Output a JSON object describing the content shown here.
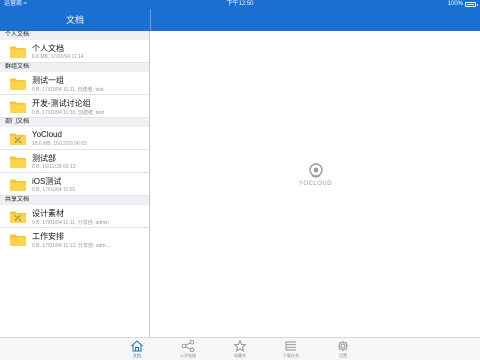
{
  "status_bar": {
    "carrier": "运营商 ≈",
    "time": "下午12:50",
    "battery": "100%"
  },
  "nav": {
    "title": "文档"
  },
  "sections": [
    {
      "header": "个人文档",
      "items": [
        {
          "name": "个人文档",
          "meta": "6.6 MB, 17/01/04 11:14",
          "icon": "folder-icon"
        }
      ]
    },
    {
      "header": "群组文档",
      "items": [
        {
          "name": "测试一组",
          "meta": "0 B, 17/01/04 11:11, 创建者: test",
          "icon": "folder-icon"
        },
        {
          "name": "开发-测试讨论组",
          "meta": "0 B, 17/01/04 11:10, 创建者: test",
          "icon": "folder-icon"
        }
      ]
    },
    {
      "header": "部门文档",
      "items": [
        {
          "name": "YoCloud",
          "meta": "18.6 MB, 16/12/28 06:03",
          "icon": "shared-folder-icon"
        },
        {
          "name": "测试部",
          "meta": "0 B, 16/12/28 02:13",
          "icon": "folder-icon"
        },
        {
          "name": "iOS测试",
          "meta": "0 B, 17/01/04 11:01",
          "icon": "folder-icon"
        }
      ]
    },
    {
      "header": "共享文档",
      "items": [
        {
          "name": "设计素材",
          "meta": "0 B, 17/01/04 11:11, 分享自: admin",
          "icon": "shared-folder-icon"
        },
        {
          "name": "工作安排",
          "meta": "0 B, 17/01/04 11:12, 分享自: adm...",
          "icon": "folder-icon"
        }
      ]
    }
  ],
  "detail": {
    "logo_text": "YOCLOUD"
  },
  "tabs": [
    {
      "label": "文档",
      "icon": "home-icon",
      "active": true
    },
    {
      "label": "公开链接",
      "icon": "share-icon",
      "active": false
    },
    {
      "label": "收藏夹",
      "icon": "star-icon",
      "active": false
    },
    {
      "label": "下载任务",
      "icon": "list-icon",
      "active": false
    },
    {
      "label": "设置",
      "icon": "gear-icon",
      "active": false
    }
  ],
  "colors": {
    "accent": "#1a6fd0",
    "folder": "#f7c531",
    "section_bg": "#efeff4",
    "tab_inactive": "#8e8e93"
  }
}
